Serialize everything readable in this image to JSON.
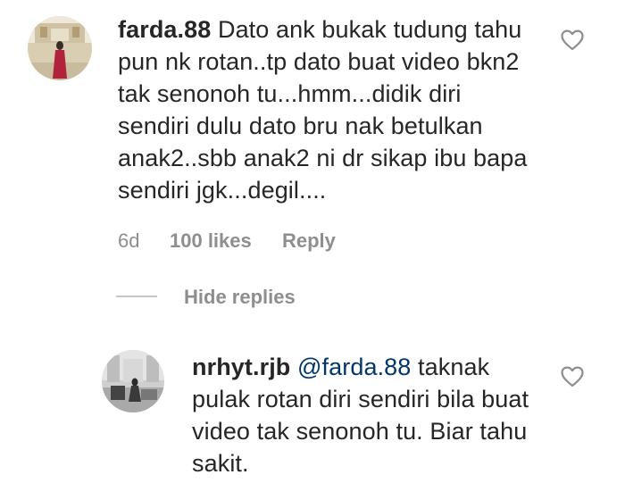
{
  "comments": [
    {
      "username": "farda.88",
      "text_lines": [
        "Dato ank bukak tudung tahu",
        "pun nk rotan..tp dato buat video bkn2",
        "tak senonoh tu...hmm...didik diri",
        "sendiri dulu dato bru nak betulkan",
        "anak2..sbb anak2 ni dr sikap ibu bapa",
        "sendiri jgk...degil...."
      ],
      "time": "6d",
      "likes": "100 likes",
      "reply_label": "Reply",
      "icons": {
        "avatar": "profile-photo-avatar",
        "like": "heart-outline-icon"
      }
    }
  ],
  "replies_toggle": {
    "label": "Hide replies"
  },
  "replies": [
    {
      "username": "nrhyt.rjb",
      "mention": "@farda.88",
      "first_line_rest": "taknak",
      "text_lines": [
        "pulak rotan diri sendiri bila buat",
        "video tak senonoh tu. Biar tahu",
        "sakit."
      ],
      "icons": {
        "avatar": "profile-photo-avatar",
        "like": "heart-outline-icon"
      }
    }
  ],
  "colors": {
    "text": "#262626",
    "secondary": "#8e8e8e",
    "mention": "#00376b",
    "divider": "#c7c7c7"
  }
}
